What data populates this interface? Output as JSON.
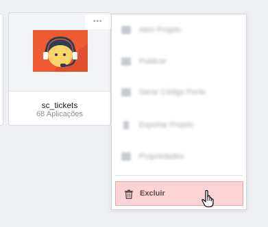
{
  "card": {
    "title": "sc_tickets",
    "subtitle": "68 Aplicações",
    "icon": "support-agent-icon",
    "icon_bg": "#f05a32"
  },
  "more_button": {
    "glyph": "•••"
  },
  "menu": {
    "items": [
      {
        "label": "Abrir Projeto",
        "icon": "folder-icon"
      },
      {
        "label": "Publicar",
        "icon": "upload-icon"
      },
      {
        "label": "Gerar Código Fonte",
        "icon": "code-icon"
      },
      {
        "label": "Exportar Projeto",
        "icon": "export-icon"
      },
      {
        "label": "Propriedades",
        "icon": "settings-icon"
      }
    ],
    "delete": {
      "label": "Excluir",
      "icon": "trash-icon",
      "bg": "#fbd3d4"
    }
  }
}
